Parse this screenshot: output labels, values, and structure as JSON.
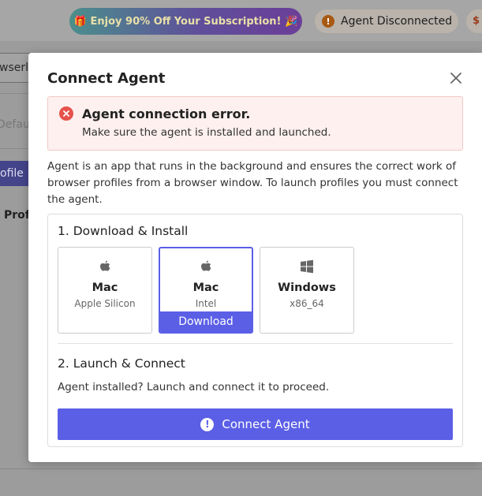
{
  "header": {
    "promo_text": "🎁 Enjoy 90% Off Your Subscription! 🎉",
    "agent_status": "Agent Disconnected",
    "status_icon": "!",
    "right_badge": "$"
  },
  "background": {
    "input_value": "wserle",
    "default_label": "Defau",
    "profile_button": "ofile",
    "profiles_label": "Profi"
  },
  "modal": {
    "title": "Connect Agent",
    "error": {
      "title": "Agent connection error.",
      "message": "Make sure the agent is installed and launched."
    },
    "description": "Agent is an app that runs in the background and ensures the correct work of browser profiles from a browser window. To launch profiles you must connect the agent.",
    "step1_title": "1. Download & Install",
    "downloads": [
      {
        "name": "Mac",
        "sub": "Apple Silicon",
        "icon": "apple-icon"
      },
      {
        "name": "Mac",
        "sub": "Intel",
        "icon": "apple-icon",
        "action": "Download"
      },
      {
        "name": "Windows",
        "sub": "x86_64",
        "icon": "windows-icon"
      }
    ],
    "step2_title": "2. Launch & Connect",
    "launch_message": "Agent installed? Launch and connect it to proceed.",
    "connect_button": "Connect Agent",
    "connect_icon": "!"
  },
  "colors": {
    "accent": "#5b5fe6",
    "error": "#e5534b",
    "error_bg": "#fdf0ef"
  }
}
